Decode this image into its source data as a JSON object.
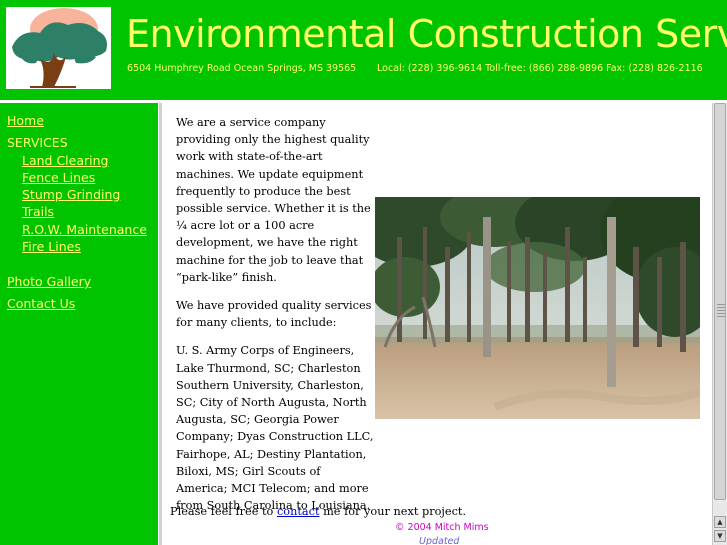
{
  "header": {
    "title": "Environmental Construction Services",
    "address": "6504 Humphrey Road Ocean Springs, MS 39565",
    "phones": "Local: (228) 396-9614  Toll-free: (866) 288-9896 Fax: (228) 826-2116"
  },
  "nav": {
    "home": "Home",
    "services_label": "SERVICES",
    "services": [
      "Land Clearing",
      "Fence Lines",
      "Stump Grinding",
      "Trails",
      "R.O.W. Maintenance",
      "Fire Lines"
    ],
    "photo_gallery": "Photo Gallery",
    "contact_us": "Contact Us"
  },
  "content": {
    "para1": "We are a service company providing only the highest quality work with state-of-the-art machines.  We update equipment frequently to produce the best possible service.  Whether it is the ¼ acre lot or a 100 acre development, we have the right machine for the job to leave that “park-like” finish.",
    "para2": "We have provided quality services for many clients, to include:",
    "para3": "U. S. Army Corps of Engineers, Lake Thurmond, SC;  Charleston Southern University, Charleston, SC;  City of North Augusta, North Augusta, SC;  Georgia Power Company;  Dyas Construction LLC, Fairhope, AL;  Destiny Plantation, Biloxi, MS;  Girl Scouts of America;  MCI Telecom;  and more from South Carolina to Louisiana.",
    "closing_before": "Please feel free to ",
    "closing_link": "contact",
    "closing_after": " me for your next project.",
    "copyright": "© 2004 Mitch Mims",
    "updated": "Updated"
  },
  "colors": {
    "green": "#00c400",
    "yellow": "#ffff66"
  },
  "icons": {
    "logo": "tree-logo",
    "scroll_up": "arrow-up-icon",
    "scroll_down": "arrow-down-icon"
  }
}
